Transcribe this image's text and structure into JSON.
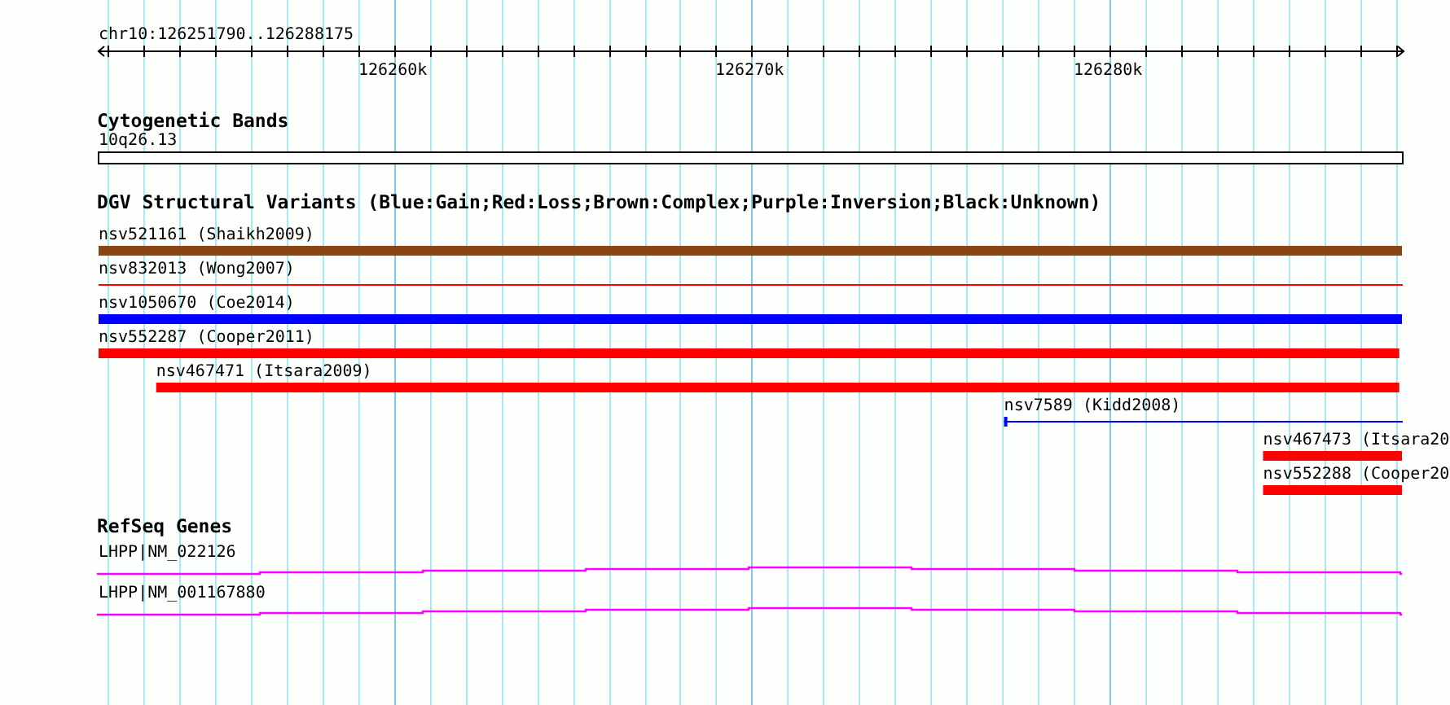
{
  "ruler": {
    "position": "chr10:126251790..126288175",
    "ticks": [
      {
        "label": "126260k"
      },
      {
        "label": "126270k"
      },
      {
        "label": "126280k"
      }
    ]
  },
  "tracks": [
    {
      "kind": "bands",
      "title": "Cytogenetic Bands",
      "features": [
        {
          "label": "10q26.13"
        }
      ]
    },
    {
      "kind": "variants",
      "title": "DGV Structural Variants (Blue:Gain;Red:Loss;Brown:Complex;Purple:Inversion;Black:Unknown)",
      "features": [
        {
          "label": "nsv521161 (Shaikh2009)",
          "kind": "bar",
          "color": "#8b4513"
        },
        {
          "label": "nsv832013 (Wong2007)",
          "kind": "line",
          "color": "#ff0000"
        },
        {
          "label": "nsv1050670 (Coe2014)",
          "kind": "bar",
          "color": "#0000ff"
        },
        {
          "label": "nsv552287 (Cooper2011)",
          "kind": "bar",
          "color": "#ff0000"
        },
        {
          "label": "nsv467471 (Itsara2009)",
          "kind": "bar",
          "color": "#ff0000"
        },
        {
          "label": "nsv7589 (Kidd2008)",
          "kind": "line",
          "color": "#0000ff"
        },
        {
          "label": "nsv467473 (Itsara20",
          "kind": "bar",
          "color": "#ff0000"
        },
        {
          "label": "nsv552288 (Cooper20",
          "kind": "bar",
          "color": "#ff0000"
        }
      ]
    },
    {
      "kind": "genes",
      "title": "RefSeq Genes",
      "features": [
        {
          "label": "LHPP|NM_022126"
        },
        {
          "label": "LHPP|NM_001167880"
        }
      ]
    }
  ]
}
